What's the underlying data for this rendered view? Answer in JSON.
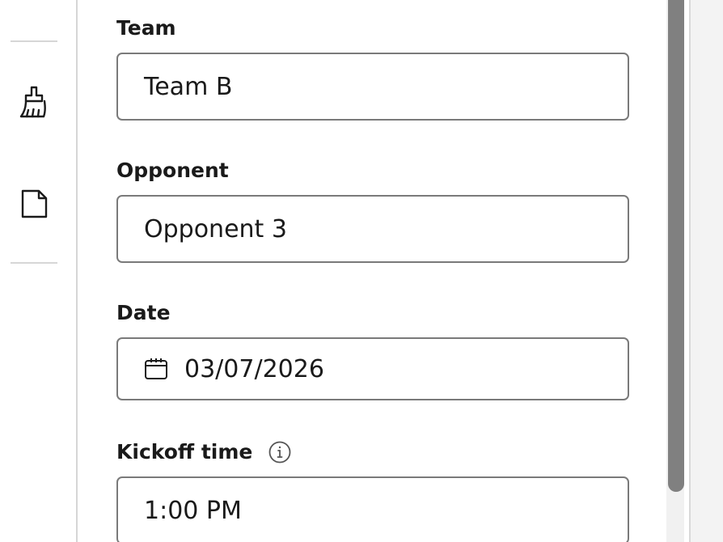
{
  "form": {
    "team": {
      "label": "Team",
      "value": "Team B"
    },
    "opponent": {
      "label": "Opponent",
      "value": "Opponent 3"
    },
    "date": {
      "label": "Date",
      "value": "03/07/2026"
    },
    "kickoff": {
      "label": "Kickoff time",
      "value": "1:00 PM"
    }
  },
  "rail": {
    "tools": [
      {
        "icon": "brush-icon"
      },
      {
        "icon": "note-icon"
      }
    ]
  },
  "icons": {
    "calendar": "calendar-icon",
    "info": "info-icon"
  },
  "colors": {
    "text": "#1a1a1a",
    "input_border": "#7a7a7a",
    "divider": "#d6d6d6",
    "scroll_thumb": "#808080"
  }
}
